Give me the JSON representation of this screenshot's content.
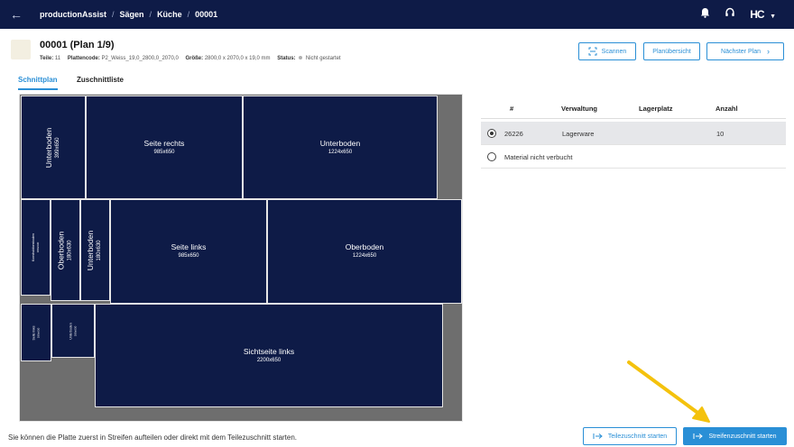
{
  "topbar": {
    "breadcrumbs": [
      "productionAssist",
      "Sägen",
      "Küche",
      "00001"
    ],
    "logo_text": "HC",
    "icons": [
      "back-arrow-icon",
      "bell-icon",
      "headset-icon",
      "chevron-down-icon"
    ]
  },
  "header": {
    "title": "00001 (Plan 1/9)",
    "meta": {
      "teile_label": "Teile:",
      "teile_value": "11",
      "plattencode_label": "Plattencode:",
      "plattencode_value": "P2_Weiss_19,0_2800,0_2070,0",
      "groesse_label": "Größe:",
      "groesse_value": "2800,0 x 2070,0 x 19,0 mm",
      "status_label": "Status:",
      "status_value": "Nicht gestartet"
    },
    "buttons": {
      "scan": "Scannen",
      "overview": "Planübersicht",
      "next": "Nächster Plan"
    }
  },
  "tabs": [
    {
      "label": "Schnittplan",
      "active": true
    },
    {
      "label": "Zuschnittliste",
      "active": false
    }
  ],
  "pieces": [
    {
      "name": "Unterboden",
      "dims": "399x650"
    },
    {
      "name": "Seite rechts",
      "dims": "985x650"
    },
    {
      "name": "Unterboden",
      "dims": "1224x650"
    },
    {
      "name": "Konstruktionsboden",
      "dims": "180x630"
    },
    {
      "name": "Oberboden",
      "dims": "180x630"
    },
    {
      "name": "Unterboden",
      "dims": "180x630"
    },
    {
      "name": "Seite links",
      "dims": "985x650"
    },
    {
      "name": "Oberboden",
      "dims": "1224x650"
    },
    {
      "name": "Seite links",
      "dims": "180x630"
    },
    {
      "name": "Unterboden",
      "dims": "180x630"
    },
    {
      "name": "Sichtseite links",
      "dims": "2200x650"
    }
  ],
  "material_table": {
    "columns": [
      "#",
      "Verwaltung",
      "Lagerplatz",
      "Anzahl"
    ],
    "rows": [
      {
        "id": "26226",
        "verwaltung": "Lagerware",
        "lagerplatz": "",
        "anzahl": "10",
        "selected": true
      }
    ],
    "unbooked_label": "Material nicht verbucht"
  },
  "footer": {
    "hint": "Sie können die Platte zuerst in Streifen aufteilen oder direkt mit dem Teilezuschnitt starten.",
    "btn_teile": "Teilezuschnitt starten",
    "btn_streifen": "Streifenzuschnitt starten"
  },
  "colors": {
    "navy": "#0e1b47",
    "accent": "#2a8fd6",
    "waste": "#6e6e6e",
    "annotation_arrow": "#f4c20d"
  }
}
